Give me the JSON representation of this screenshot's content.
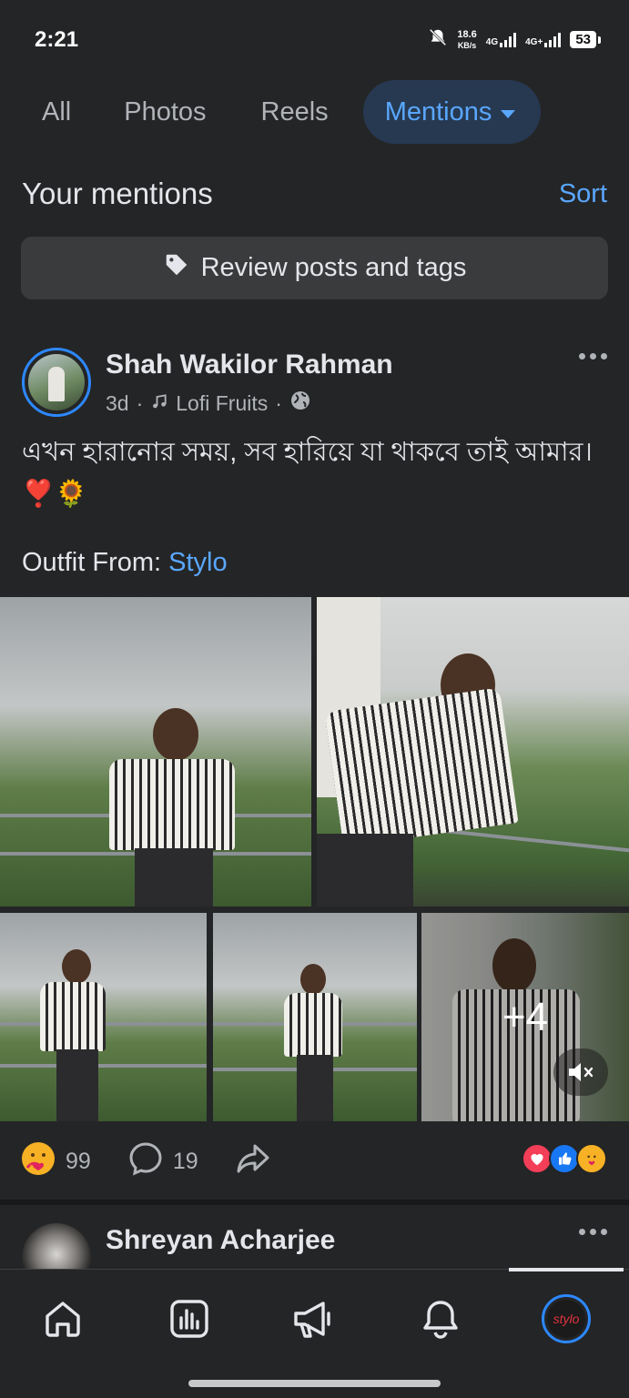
{
  "status_bar": {
    "time": "2:21",
    "speed_value": "18.6",
    "speed_unit": "KB/s",
    "net1": "4G",
    "net2": "4G+",
    "battery": "53",
    "icons": [
      "mute-bell-icon",
      "signal-icon",
      "signal-icon",
      "battery-icon"
    ]
  },
  "tabs": [
    {
      "label": "All"
    },
    {
      "label": "Photos"
    },
    {
      "label": "Reels"
    },
    {
      "label": "Mentions",
      "active": true
    }
  ],
  "mentions": {
    "title": "Your mentions",
    "sort_label": "Sort"
  },
  "review_button": {
    "label": "Review posts and tags",
    "icon": "tag-icon"
  },
  "post": {
    "author": "Shah Wakilor Rahman",
    "time": "3d",
    "audio": "Lofi Fruits",
    "privacy_icon": "globe-icon",
    "text": "এখন হারানোর সময়, সব হারিয়ে যা থাকবে তাই আমার। ❣️🌻",
    "outfit_prefix": "Outfit From: ",
    "outfit_link": "Stylo",
    "more_photos": "+4",
    "reaction_count": "99",
    "comment_count": "19",
    "accent": "#2d88ff",
    "link_color": "#5aa7ff"
  },
  "next_post": {
    "author": "Shreyan Acharjee"
  },
  "bottom_nav": {
    "items": [
      "home-icon",
      "dashboard-icon",
      "megaphone-icon",
      "bell-icon",
      "profile-avatar"
    ],
    "profile_text": "stylo"
  }
}
